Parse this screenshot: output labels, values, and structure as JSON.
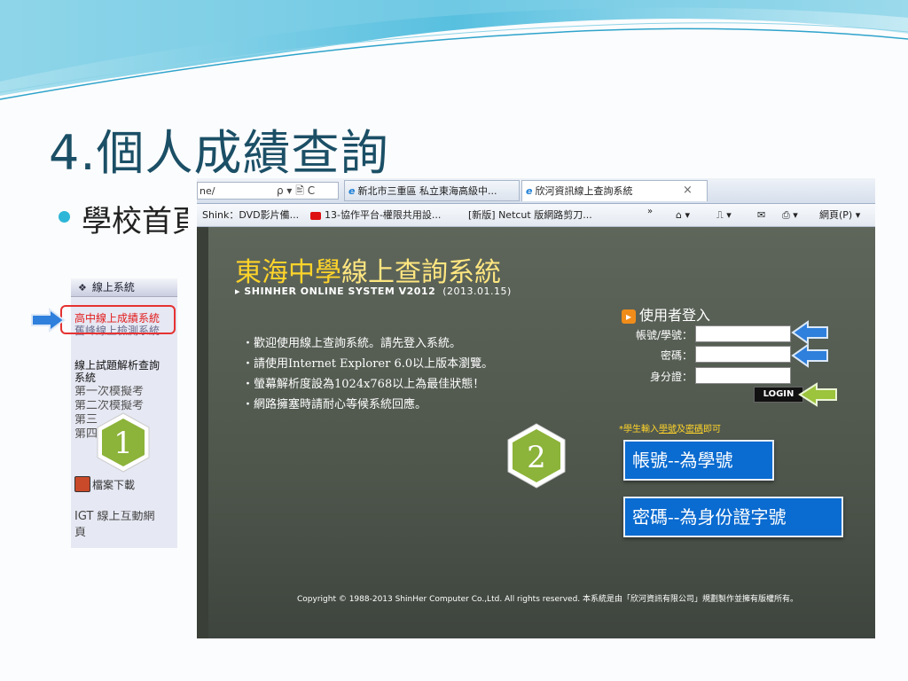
{
  "slide": {
    "title": "4.個人成績查詢",
    "bullet": "學校首頁"
  },
  "left_menu": {
    "header": "線上系統",
    "items": [
      "高中線上成績系統",
      "舊峰線上檢測系統",
      "線上試題解析查詢",
      "系統",
      "第一次模擬考",
      "第二次模擬考",
      "第三",
      "第四",
      "檔案下載",
      "IGT 線上互動網",
      "頁"
    ],
    "badge": "1"
  },
  "browser": {
    "address": "ne/",
    "address_controls": "ρ ▾ 🖹 C",
    "tabs": [
      {
        "label": "新北市三重區 私立東海高級中..."
      },
      {
        "label": "欣河資訊線上查詢系統"
      }
    ],
    "tab_close": "×",
    "favorites": [
      "Shink：DVD影片備...",
      "13-協作平台-權限共用設...",
      "[新版] Netcut 版網路剪刀..."
    ],
    "fav_more": "»",
    "toolbar": {
      "home": "⌂ ▾",
      "feed": "⎍ ▾",
      "mail": "✉",
      "print": "⎙ ▾",
      "page_menu": "網頁(P) ▾"
    }
  },
  "login_page": {
    "title_bold": "東海中學",
    "title_rest": "線上查詢系統",
    "subtitle": "▸ SHINHER ONLINE SYSTEM V2012",
    "date": "(2013.01.15)",
    "notices": [
      "・歡迎使用線上查詢系統。請先登入系統。",
      "・請使用Internet Explorer 6.0以上版本瀏覽。",
      "・螢幕解析度設為1024x768以上為最佳狀態！",
      "・網路擁塞時請耐心等候系統回應。"
    ],
    "login_title": "使用者登入",
    "labels": {
      "account": "帳號/學號：",
      "password": "密碼：",
      "id": "身分證："
    },
    "login_button": "LOGIN",
    "hint_prefix": "*學生輸入",
    "hint_word1": "學號",
    "hint_mid": "及",
    "hint_word2": "密碼",
    "hint_suffix": "即可",
    "copyright": "Copyright © 1988-2013 ShinHer Computer Co.,Ltd. All rights reserved. 本系統是由「欣河資訊有限公司」規劃製作並擁有版權所有。"
  },
  "callouts": {
    "account": "帳號--為學號",
    "password": "密碼--為身份證字號"
  },
  "badge2": "2",
  "colors": {
    "title": "#1b4f66",
    "accent": "#2db6d8",
    "badge_green": "#8cb33a",
    "callout_blue": "#0a6bd0",
    "login_gold": "#ffd42a"
  }
}
